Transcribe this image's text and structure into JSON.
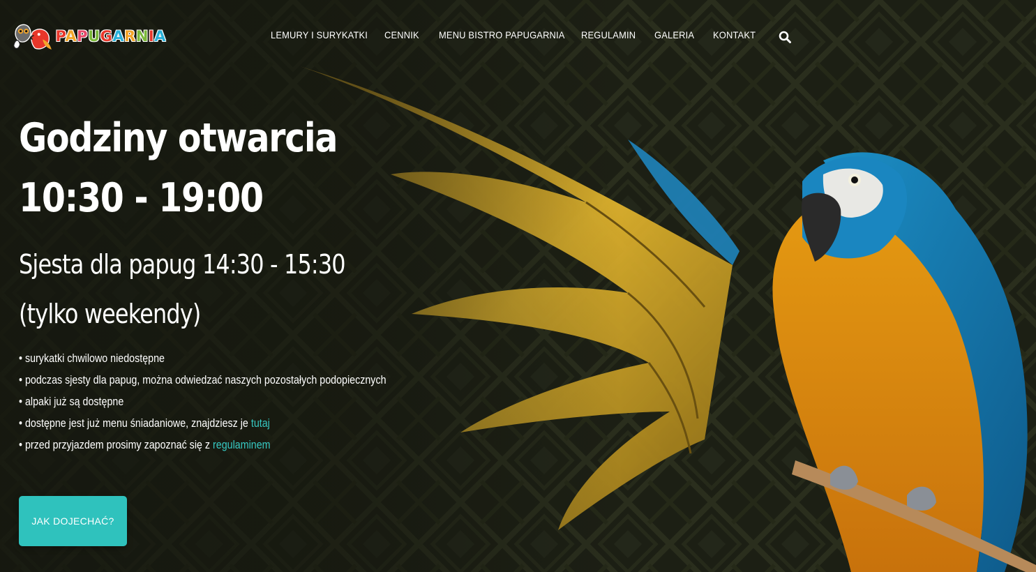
{
  "brand": {
    "name_letters": [
      "P",
      "A",
      "P",
      "U",
      "G",
      "A",
      "R",
      "N",
      "I",
      "A"
    ]
  },
  "nav": {
    "items": [
      {
        "label": "LEMURY I SURYKATKI"
      },
      {
        "label": "CENNIK"
      },
      {
        "label": "MENU BISTRO PAPUGARNIA"
      },
      {
        "label": "REGULAMIN"
      },
      {
        "label": "GALERIA"
      },
      {
        "label": "KONTAKT"
      }
    ],
    "search_icon": "search-icon"
  },
  "hero": {
    "title": "Godziny otwarcia 10:30 - 19:00",
    "subtitle": "Sjesta dla papug 14:30 - 15:30 (tylko weekendy)",
    "notes": [
      {
        "text": "• surykatki chwilowo niedostępne"
      },
      {
        "text": "• podczas sjesty dla papug, można odwiedzać naszych pozostałych podopiecznych"
      },
      {
        "text": "• alpaki już są dostępne"
      },
      {
        "text": "• dostępne jest już menu śniadaniowe, znajdziesz je ",
        "link": "tutaj"
      },
      {
        "text": "• przed przyjazdem prosimy zapoznać się z ",
        "link": "regulaminem"
      }
    ],
    "cta_label": "JAK DOJECHAĆ?"
  },
  "colors": {
    "accent": "#2fc2bd",
    "link": "#36c8c2",
    "background": "#1a1c12"
  }
}
